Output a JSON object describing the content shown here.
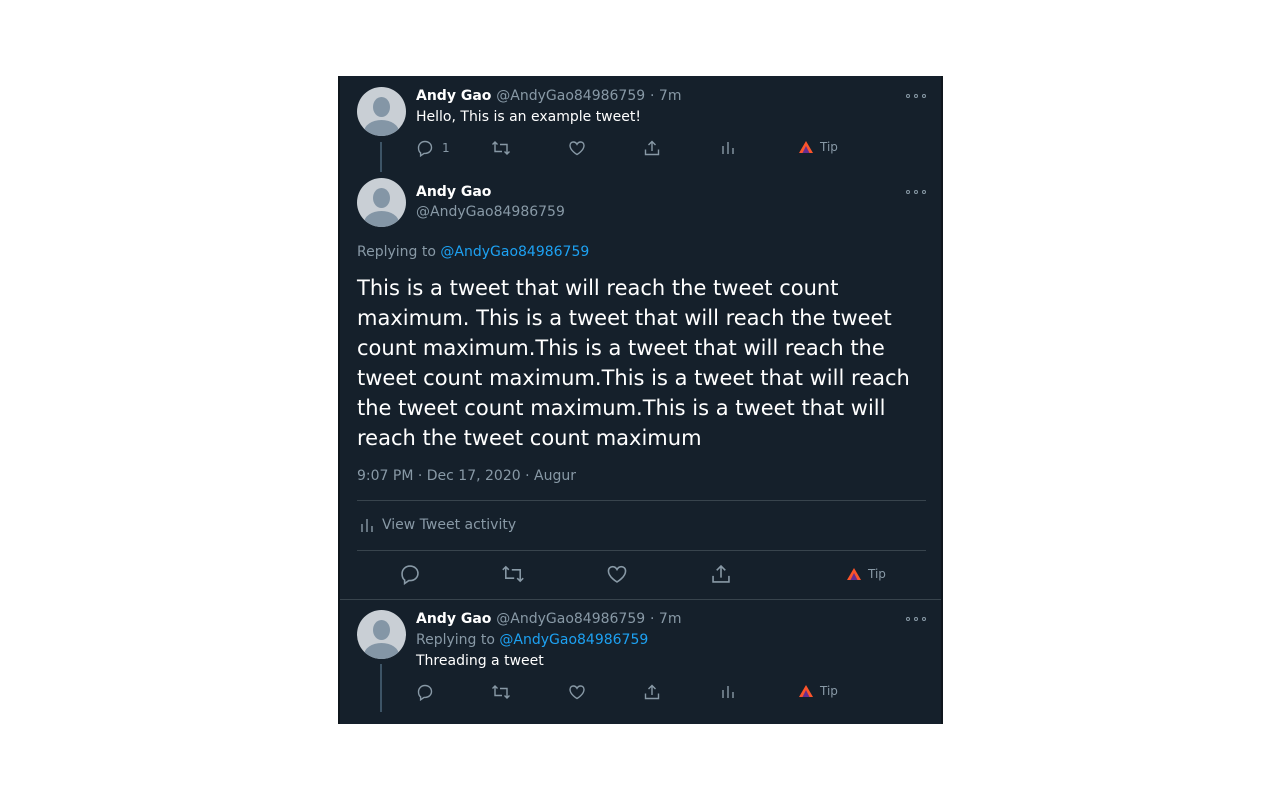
{
  "tweet1": {
    "name": "Andy Gao",
    "handle": "@AndyGao84986759",
    "time": "· 7m",
    "text": "Hello, This is an example tweet!",
    "reply_count": "1",
    "tip_label": "Tip"
  },
  "main_tweet": {
    "name": "Andy Gao",
    "handle": "@AndyGao84986759",
    "replying_prefix": "Replying to",
    "replying_handle": "@AndyGao84986759",
    "text": "This is a tweet that will reach the tweet count maximum. This is a tweet that will reach the tweet count maximum.This is a tweet that will reach the tweet count maximum.This is a tweet that will reach the tweet count maximum.This is a tweet that will reach the tweet count maximum",
    "timestamp": "9:07 PM · Dec 17, 2020 · Augur",
    "view_activity": "View Tweet activity",
    "tip_label": "Tip"
  },
  "tweet3": {
    "name": "Andy Gao",
    "handle": "@AndyGao84986759",
    "time": "· 7m",
    "replying_prefix": "Replying to",
    "replying_handle": "@AndyGao84986759",
    "text": "Threading a tweet",
    "tip_label": "Tip"
  },
  "colors": {
    "background": "#15202b",
    "text": "#ffffff",
    "muted": "#8899a6",
    "link": "#1da1f2",
    "divider": "#38444d"
  },
  "icons": [
    "reply-icon",
    "retweet-icon",
    "like-icon",
    "share-icon",
    "analytics-icon",
    "brave-tip-icon",
    "more-icon"
  ]
}
